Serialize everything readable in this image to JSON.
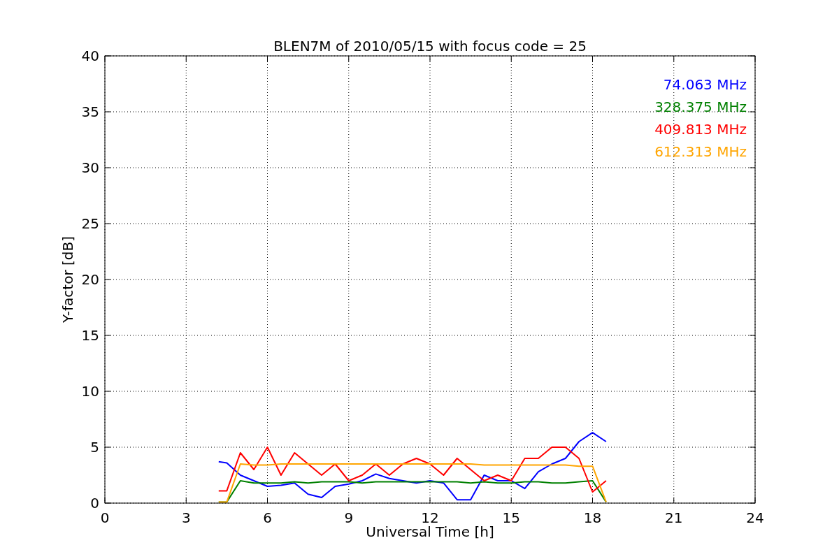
{
  "chart_data": {
    "type": "line",
    "title": "BLEN7M of 2010/05/15 with focus code = 25",
    "xlabel": "Universal Time [h]",
    "ylabel": "Y-factor [dB]",
    "x": [
      4.2,
      4.5,
      5,
      5.5,
      6,
      6.5,
      7,
      7.5,
      8,
      8.5,
      9,
      9.5,
      10,
      10.5,
      11,
      11.5,
      12,
      12.5,
      13,
      13.5,
      14,
      14.5,
      15,
      15.5,
      16,
      16.5,
      17,
      17.5,
      18,
      18.5
    ],
    "series": [
      {
        "name": "74.063 MHz",
        "color": "#0000ff",
        "values": [
          3.7,
          3.6,
          2.5,
          2.0,
          1.5,
          1.6,
          1.8,
          0.8,
          0.5,
          1.5,
          1.7,
          2.0,
          2.6,
          2.2,
          2.0,
          1.8,
          2.0,
          1.8,
          0.3,
          0.3,
          2.5,
          2.0,
          2.0,
          1.3,
          2.8,
          3.5,
          4.0,
          5.5,
          6.3,
          5.5
        ]
      },
      {
        "name": "328.375 MHz",
        "color": "#008000",
        "values": [
          0.1,
          0.1,
          2.0,
          1.8,
          1.8,
          1.8,
          1.9,
          1.8,
          1.9,
          1.9,
          1.9,
          1.8,
          1.9,
          1.9,
          1.9,
          1.9,
          1.9,
          1.9,
          1.9,
          1.8,
          1.9,
          1.8,
          1.8,
          1.9,
          1.9,
          1.8,
          1.8,
          1.9,
          2.0,
          0.1
        ]
      },
      {
        "name": "409.813 MHz",
        "color": "#ff0000",
        "values": [
          1.1,
          1.1,
          4.5,
          3.0,
          5.0,
          2.5,
          4.5,
          3.5,
          2.5,
          3.5,
          2.0,
          2.5,
          3.5,
          2.5,
          3.5,
          4.0,
          3.5,
          2.5,
          4.0,
          3.0,
          2.0,
          2.5,
          2.0,
          4.0,
          4.0,
          5.0,
          5.0,
          4.0,
          1.0,
          2.0
        ]
      },
      {
        "name": "612.313 MHz",
        "color": "#ffa500",
        "values": [
          0.1,
          0.1,
          3.5,
          3.4,
          3.4,
          3.5,
          3.5,
          3.5,
          3.5,
          3.5,
          3.5,
          3.5,
          3.5,
          3.5,
          3.5,
          3.5,
          3.5,
          3.5,
          3.5,
          3.5,
          3.4,
          3.4,
          3.4,
          3.4,
          3.4,
          3.4,
          3.4,
          3.3,
          3.3,
          0.1
        ]
      }
    ],
    "grid": true,
    "xlim": [
      0,
      24
    ],
    "ylim": [
      0,
      40
    ],
    "xticks": [
      0,
      3,
      6,
      9,
      12,
      15,
      18,
      21,
      24
    ],
    "yticks": [
      0,
      5,
      10,
      15,
      20,
      25,
      30,
      35,
      40
    ]
  }
}
